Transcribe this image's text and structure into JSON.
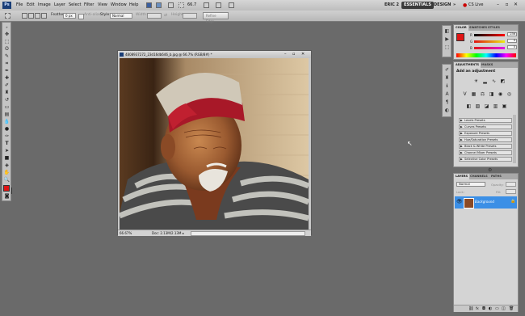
{
  "app": {
    "logo": "Ps"
  },
  "menu": [
    "File",
    "Edit",
    "Image",
    "Layer",
    "Select",
    "Filter",
    "View",
    "Window",
    "Help"
  ],
  "topbar": {
    "zoom_value": "66.7",
    "workspaces": [
      "ERIC 2",
      "ESSENTIALS",
      "DESIGN"
    ],
    "more": "»",
    "cslive": "CS Live",
    "window_controls": [
      "–",
      "▫",
      "✕"
    ]
  },
  "options": {
    "feather_label": "Feather:",
    "feather_value": "0 px",
    "antialias_label": "Anti-alias",
    "style_label": "Style:",
    "style_value": "Normal",
    "width_label": "Width:",
    "height_label": "Height:",
    "refine_label": "Refine Edge..."
  },
  "document": {
    "title": "4808937272_23d16db646_b.jpg @ 66.7% (RGB/8#) *",
    "zoom": "66.67%",
    "status": "Doc: 2.13M/2.13M"
  },
  "colors": {
    "foreground": "#e01414",
    "background": "#ffffff",
    "layer_selected": "#3b8fe6",
    "panel_bg": "#d4d4d4"
  },
  "color_panel": {
    "tabs": [
      "COLOR",
      "SWATCHES",
      "STYLES"
    ],
    "channels": [
      {
        "label": "R",
        "value": "236"
      },
      {
        "label": "G",
        "value": "0"
      },
      {
        "label": "B",
        "value": "0"
      }
    ]
  },
  "adjustments_panel": {
    "tabs": [
      "ADJUSTMENTS",
      "MASKS"
    ],
    "heading": "Add an adjustment",
    "presets": [
      "Levels Presets",
      "Curves Presets",
      "Exposure Presets",
      "Hue/Saturation Presets",
      "Black & White Presets",
      "Channel Mixer Presets",
      "Selective Color Presets"
    ]
  },
  "layers_panel": {
    "tabs": [
      "LAYERS",
      "CHANNELS",
      "PATHS"
    ],
    "blend_mode": "Normal",
    "opacity_label": "Opacity:",
    "lock_label": "Lock:",
    "fill_label": "Fill:",
    "layer_name": "Background",
    "bottom_icons": [
      "link-icon",
      "fx-icon",
      "mask-icon",
      "adjustment-icon",
      "folder-icon",
      "new-layer-icon",
      "trash-icon"
    ]
  }
}
